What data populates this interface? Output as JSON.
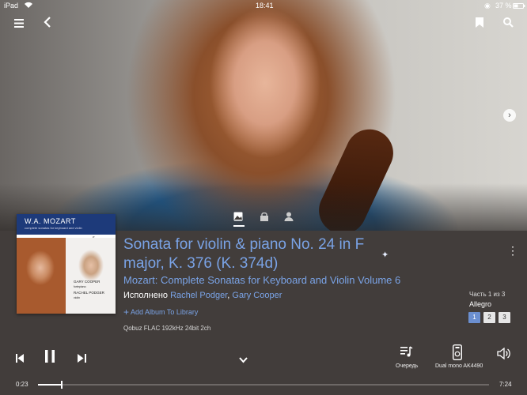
{
  "status": {
    "device": "iPad",
    "time": "18:41",
    "battery": "37 %"
  },
  "hero": {
    "view_tabs": [
      "photo-icon",
      "lock-icon",
      "person-icon"
    ]
  },
  "track": {
    "title": "Sonata for violin & piano No. 24 in F major, K. 376 (K. 374d)",
    "album": "Mozart: Complete Sonatas for Keyboard and Violin Volume 6",
    "performed_label": "Исполнено",
    "performer1": "Rachel Podger",
    "separator": ",",
    "performer2": "Gary Cooper",
    "add_album": "Add Album To Library",
    "format": "Qobuz FLAC 192kHz 24bit 2ch"
  },
  "cover": {
    "title": "W.A. MOZART",
    "subtitle": "complete sonatas for keyboard and violin",
    "volume": "6",
    "artist1": "GARY COOPER",
    "artist1_role": "fortepiano",
    "artist2": "RACHEL PODGER",
    "artist2_role": "violin"
  },
  "movements": {
    "part_info": "Часть 1 из 3",
    "current": "Allegro",
    "buttons": [
      "1",
      "2",
      "3"
    ],
    "active_index": 0
  },
  "controls": {
    "queue_label": "Очередь",
    "device_label": "Dual mono AK4490"
  },
  "progress": {
    "elapsed": "0:23",
    "total": "7:24",
    "fraction": 0.052
  },
  "colors": {
    "accent": "#7aa3e6",
    "panel": "#423d3b",
    "active_button": "#6b8fd0"
  }
}
